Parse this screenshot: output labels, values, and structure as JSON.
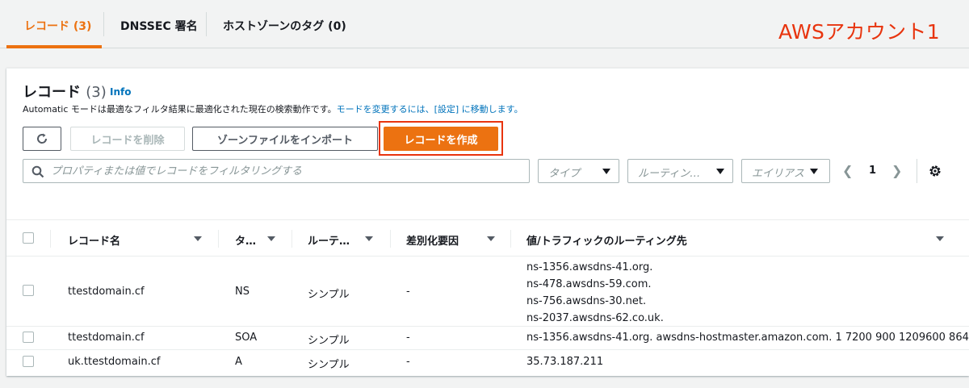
{
  "tabs": [
    {
      "label": "レコード (3)",
      "active": true
    },
    {
      "label": "DNSSEC 署名",
      "active": false
    },
    {
      "label": "ホストゾーンのタグ (0)",
      "active": false
    }
  ],
  "annotation": "AWSアカウント1",
  "panel": {
    "title": "レコード",
    "count": "(3)",
    "info": "Info",
    "description": "Automatic モードは最適なフィルタ結果に最適化された現在の検索動作です。",
    "description_link": "モードを変更するには、[設定] に移動します。"
  },
  "toolbar": {
    "refresh_icon": "refresh-icon",
    "delete_label": "レコードを削除",
    "import_label": "ゾーンファイルをインポート",
    "create_label": "レコードを作成"
  },
  "filters": {
    "search_placeholder": "プロパティまたは値でレコードをフィルタリングする",
    "type_label": "タイプ",
    "routing_label": "ルーティン…",
    "alias_label": "エイリアス"
  },
  "pagination": {
    "current": "1"
  },
  "table": {
    "columns": [
      "レコード名",
      "タ…",
      "ルーテ…",
      "差別化要因",
      "値/トラフィックのルーティング先"
    ],
    "rows": [
      {
        "name": "ttestdomain.cf",
        "type": "NS",
        "routing": "シンプル",
        "diff": "-",
        "values": [
          "ns-1356.awsdns-41.org.",
          "ns-478.awsdns-59.com.",
          "ns-756.awsdns-30.net.",
          "ns-2037.awsdns-62.co.uk."
        ]
      },
      {
        "name": "ttestdomain.cf",
        "type": "SOA",
        "routing": "シンプル",
        "diff": "-",
        "values": [
          "ns-1356.awsdns-41.org. awsdns-hostmaster.amazon.com. 1 7200 900 1209600 864"
        ]
      },
      {
        "name": "uk.ttestdomain.cf",
        "type": "A",
        "routing": "シンプル",
        "diff": "-",
        "values": [
          "35.73.187.211"
        ]
      }
    ]
  },
  "colors": {
    "accent": "#ec7211",
    "link": "#0073bb",
    "annotation": "#e8340e"
  }
}
